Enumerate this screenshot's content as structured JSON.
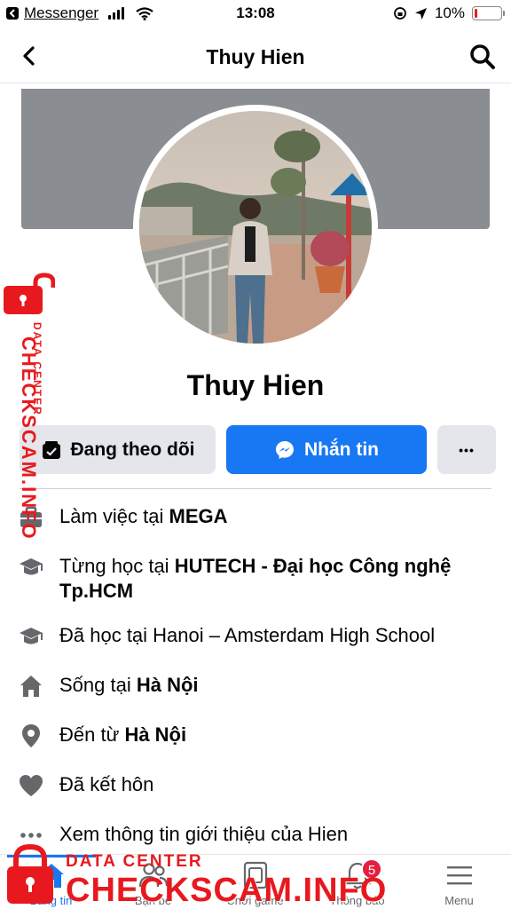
{
  "status_bar": {
    "back_app": "Messenger",
    "time": "13:08",
    "battery": "10%",
    "battery_level": 0.1,
    "battery_color": "#e2231a"
  },
  "nav": {
    "title": "Thuy Hien"
  },
  "profile": {
    "name": "Thuy Hien"
  },
  "actions": {
    "follow_label": "Đang theo dõi",
    "message_label": "Nhắn tin",
    "more_label": "•••"
  },
  "info": [
    {
      "icon": "briefcase-icon",
      "prefix": "Làm việc tại ",
      "bold": "MEGA"
    },
    {
      "icon": "graduation-cap-icon",
      "prefix": "Từng học tại ",
      "bold": "HUTECH - Đại học Công nghệ Tp.HCM"
    },
    {
      "icon": "graduation-cap-icon",
      "prefix": "Đã học tại Hanoi – Amsterdam High School",
      "bold": ""
    },
    {
      "icon": "home-icon",
      "prefix": "Sống tại ",
      "bold": "Hà Nội"
    },
    {
      "icon": "location-pin-icon",
      "prefix": "Đến từ ",
      "bold": "Hà Nội"
    },
    {
      "icon": "heart-icon",
      "prefix": "Đã kết hôn",
      "bold": ""
    },
    {
      "icon": "more-dots-icon",
      "prefix": "Xem thông tin giới thiệu của Hien",
      "bold": ""
    }
  ],
  "tabs": [
    {
      "label": "Bảng tin",
      "icon": "home-icon"
    },
    {
      "label": "Bạn bè",
      "icon": "friends-icon"
    },
    {
      "label": "Chơi game",
      "icon": "game-icon"
    },
    {
      "label": "Thông báo",
      "icon": "bell-icon",
      "badge": "5"
    },
    {
      "label": "Menu",
      "icon": "menu-icon"
    }
  ],
  "watermark": {
    "data_center": "DATA CENTER",
    "brand": "CHECKSCAM.INFO"
  },
  "colors": {
    "accent": "#1877f2",
    "watermark": "#e8191e",
    "badge": "#e41e3f"
  }
}
